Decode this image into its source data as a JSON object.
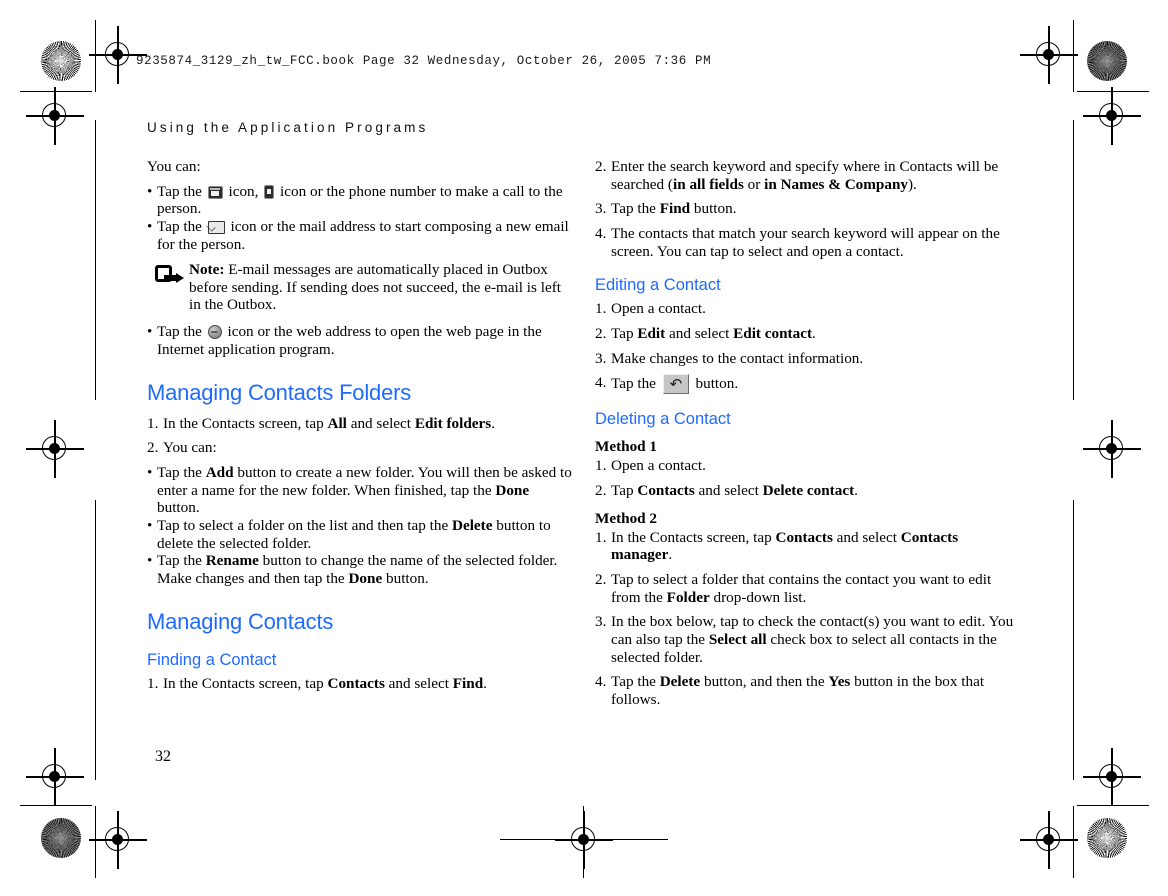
{
  "print_slug": "9235874_3129_zh_tw_FCC.book  Page 32  Wednesday, October 26, 2005  7:36 PM",
  "running_head": "Using the Application Programs",
  "page_number": "32",
  "accent_color": "#1f6bff",
  "icons": {
    "phone": "telephone-icon",
    "mobile": "mobile-phone-icon",
    "mail": "envelope-icon",
    "web": "globe-icon",
    "back": "back-arrow-icon",
    "note": "note-pointer-icon",
    "registration": "registration-target-icon",
    "radial": "radial-resolution-target-icon"
  },
  "left_column": {
    "intro": "You can:",
    "bullets_1": [
      {
        "parts": [
          {
            "t": "Tap the ",
            "b": false
          },
          {
            "icon": "phone"
          },
          {
            "t": " icon, ",
            "b": false
          },
          {
            "icon": "mobile"
          },
          {
            "t": " icon or the phone number to make a call to the person.",
            "b": false
          }
        ]
      },
      {
        "parts": [
          {
            "t": "Tap the ",
            "b": false
          },
          {
            "icon": "mail"
          },
          {
            "t": " icon or the mail address to start composing a new email for the person.",
            "b": false
          }
        ]
      }
    ],
    "note": {
      "label": "Note:",
      "text": " E-mail messages are automatically placed in Outbox before sending. If sending does not succeed, the e-mail is left in the Outbox."
    },
    "bullets_2": [
      {
        "parts": [
          {
            "t": "Tap the ",
            "b": false
          },
          {
            "icon": "web"
          },
          {
            "t": " icon or the web address to open the web page in the Internet application program.",
            "b": false
          }
        ]
      }
    ],
    "section_1": {
      "heading": "Managing Contacts Folders",
      "steps": [
        {
          "num": "1.",
          "parts": [
            {
              "t": "In the Contacts screen, tap ",
              "b": false
            },
            {
              "t": "All",
              "b": true
            },
            {
              "t": " and select ",
              "b": false
            },
            {
              "t": "Edit folders",
              "b": true
            },
            {
              "t": ".",
              "b": false
            }
          ]
        },
        {
          "num": "2.",
          "parts": [
            {
              "t": "You can:",
              "b": false
            }
          ]
        }
      ],
      "bullets": [
        {
          "parts": [
            {
              "t": "Tap the ",
              "b": false
            },
            {
              "t": "Add",
              "b": true
            },
            {
              "t": " button to create a new folder. You will then be asked to enter a name for the new folder. When finished, tap the ",
              "b": false
            },
            {
              "t": "Done",
              "b": true
            },
            {
              "t": " button.",
              "b": false
            }
          ]
        },
        {
          "parts": [
            {
              "t": " Tap to select a folder on the list and then tap the ",
              "b": false
            },
            {
              "t": "Delete",
              "b": true
            },
            {
              "t": " button to delete the selected folder.",
              "b": false
            }
          ]
        },
        {
          "parts": [
            {
              "t": "Tap the ",
              "b": false
            },
            {
              "t": "Rename",
              "b": true
            },
            {
              "t": " button to change the name of the selected folder. Make changes and then tap the ",
              "b": false
            },
            {
              "t": "Done",
              "b": true
            },
            {
              "t": " button.",
              "b": false
            }
          ]
        }
      ]
    },
    "section_2": {
      "heading": "Managing Contacts",
      "subheading": "Finding a Contact",
      "steps": [
        {
          "num": "1.",
          "parts": [
            {
              "t": "In the Contacts screen, tap ",
              "b": false
            },
            {
              "t": "Contacts",
              "b": true
            },
            {
              "t": " and select ",
              "b": false
            },
            {
              "t": "Find",
              "b": true
            },
            {
              "t": ".",
              "b": false
            }
          ]
        }
      ]
    }
  },
  "right_column": {
    "finding_steps": [
      {
        "num": "2.",
        "parts": [
          {
            "t": "Enter the search keyword and specify where in Contacts will be searched (",
            "b": false
          },
          {
            "t": "in all fields",
            "b": true
          },
          {
            "t": " or ",
            "b": false
          },
          {
            "t": "in Names & Company",
            "b": true
          },
          {
            "t": ").",
            "b": false
          }
        ]
      },
      {
        "num": "3.",
        "parts": [
          {
            "t": "Tap the ",
            "b": false
          },
          {
            "t": "Find",
            "b": true
          },
          {
            "t": " button.",
            "b": false
          }
        ]
      },
      {
        "num": "4.",
        "parts": [
          {
            "t": "The contacts that match your search keyword will appear on the screen. You can tap to select and open a contact.",
            "b": false
          }
        ]
      }
    ],
    "editing": {
      "heading": "Editing a Contact",
      "steps": [
        {
          "num": "1.",
          "parts": [
            {
              "t": "Open a contact.",
              "b": false
            }
          ]
        },
        {
          "num": "2.",
          "parts": [
            {
              "t": "Tap ",
              "b": false
            },
            {
              "t": "Edit",
              "b": true
            },
            {
              "t": " and select ",
              "b": false
            },
            {
              "t": "Edit contact",
              "b": true
            },
            {
              "t": ".",
              "b": false
            }
          ]
        },
        {
          "num": "3.",
          "parts": [
            {
              "t": "Make changes to the contact information.",
              "b": false
            }
          ]
        },
        {
          "num": "4.",
          "parts": [
            {
              "t": "Tap the ",
              "b": false
            },
            {
              "icon": "back"
            },
            {
              "t": " button.",
              "b": false
            }
          ]
        }
      ]
    },
    "deleting": {
      "heading": "Deleting a Contact",
      "method_1_label": "Method 1",
      "method_1_steps": [
        {
          "num": "1.",
          "parts": [
            {
              "t": "Open a contact.",
              "b": false
            }
          ]
        },
        {
          "num": "2.",
          "parts": [
            {
              "t": "Tap ",
              "b": false
            },
            {
              "t": "Contacts",
              "b": true
            },
            {
              "t": " and select ",
              "b": false
            },
            {
              "t": "Delete contact",
              "b": true
            },
            {
              "t": ".",
              "b": false
            }
          ]
        }
      ],
      "method_2_label": "Method 2",
      "method_2_steps": [
        {
          "num": "1.",
          "parts": [
            {
              "t": "In the Contacts screen, tap ",
              "b": false
            },
            {
              "t": "Contacts",
              "b": true
            },
            {
              "t": " and select ",
              "b": false
            },
            {
              "t": "Contacts manager",
              "b": true
            },
            {
              "t": ".",
              "b": false
            }
          ]
        },
        {
          "num": "2.",
          "parts": [
            {
              "t": "Tap to select a folder that contains the contact you want to edit from the ",
              "b": false
            },
            {
              "t": "Folder",
              "b": true
            },
            {
              "t": " drop-down list.",
              "b": false
            }
          ]
        },
        {
          "num": "3.",
          "parts": [
            {
              "t": "In the box below, tap to check the contact(s) you want to edit. You can also tap the ",
              "b": false
            },
            {
              "t": "Select all",
              "b": true
            },
            {
              "t": " check box to select all contacts in the selected folder.",
              "b": false
            }
          ]
        },
        {
          "num": "4.",
          "parts": [
            {
              "t": "Tap the ",
              "b": false
            },
            {
              "t": "Delete",
              "b": true
            },
            {
              "t": " button, and then the ",
              "b": false
            },
            {
              "t": "Yes",
              "b": true
            },
            {
              "t": " button in the box that follows.",
              "b": false
            }
          ]
        }
      ]
    }
  }
}
